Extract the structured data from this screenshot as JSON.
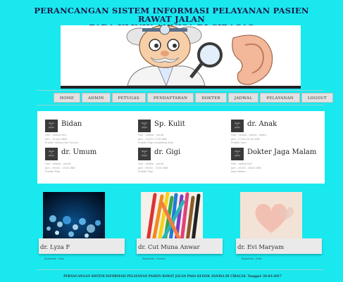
{
  "header": {
    "title_line1": "PERANCANGAN SISTEM INFORMASI PELAYANAN PASIEN RAWAT JALAN",
    "title_line2": "PADA KLINIK ANNISA DI CIRACAS"
  },
  "nav": {
    "items": [
      "HOME",
      "ADMIN",
      "PETUGAS",
      "PENDAFTARAN",
      "DOKTER",
      "JADWAL",
      "PELAYANAN",
      "LOGOUT"
    ]
  },
  "schedules": [
    {
      "name": "Bidan",
      "hari": "Hari : setiap hari",
      "jam": "Jam : 24 Jam WIB",
      "praktik": "Praktik Setiap Hari 24 Jam"
    },
    {
      "name": "Sp. Kulit",
      "hari": "Hari : selasa - jumat",
      "jam": "Jam : 10:00-17:00 WIB",
      "praktik": "Praktik Pagi menjelang Sore"
    },
    {
      "name": "dr. Anak",
      "hari": "Hari : selasa - kamis - sabtu",
      "jam": "Jam : 17:00-20:00 WIB",
      "praktik": "Praktik Sore"
    },
    {
      "name": "dr. Umum",
      "hari": "Hari : selasa - jumat",
      "jam": "Jam : 09:00 - 13:00 WIB",
      "praktik": "Praktik Pagi"
    },
    {
      "name": "dr. Gigi",
      "hari": "Hari : selasa - jumat",
      "jam": "Jam : 09:00 - 13:00 WIB",
      "praktik": "Praktik Pagi"
    },
    {
      "name": "Dokter Jaga Malam",
      "hari": "Hari : setiap hari",
      "jam": "Jam : 20:00 - 08:00 WIB",
      "praktik": "Jaga Malam"
    }
  ],
  "doctors": [
    {
      "name": "dr. Lyza F",
      "spesialis": "Spesialis : Gigi"
    },
    {
      "name": "dr. Cut Muna Anwar",
      "spesialis": "Spesialis : Umum"
    },
    {
      "name": "dr. Evi Maryam",
      "spesialis": "Spesialis : Kulit"
    }
  ],
  "footer": {
    "text": "PERANCANGAN SISTEM INFORMASI PELAYANAN PASIEN RAWAT JALAN PADA KLINIK ANNISA DI CIRACAS. Tanggal: 26-03-2017"
  },
  "icon_text": "gitigra\nV\ngitigra",
  "colors": {
    "background": "#19e8ee",
    "panel": "#ffffff",
    "nav": "#e2e2e2"
  }
}
